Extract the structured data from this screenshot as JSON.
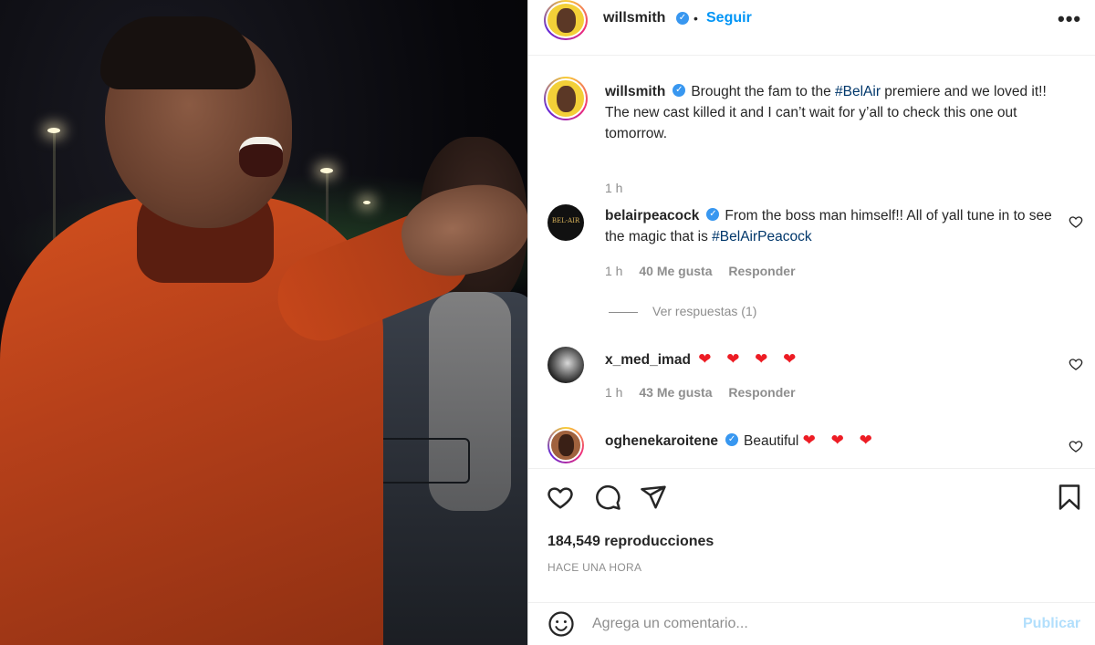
{
  "post": {
    "author": "willsmith",
    "follow_label": "Seguir",
    "dot": "•",
    "more_label": "•••",
    "caption_username": "willsmith",
    "caption_before_tag": "Brought the fam to the ",
    "caption_tag": "#BelAir",
    "caption_after_tag": " premiere and we loved it!! The new cast killed it and I can’t wait for y’all to check this one out tomorrow.",
    "caption_time": "1 h"
  },
  "comments": [
    {
      "username": "belairpeacock",
      "verified": true,
      "text_before_tag": "From the boss man himself!! All of yall tune in to see the magic that is ",
      "text_tag": "#BelAirPeacock",
      "time": "1 h",
      "likes": "40 Me gusta",
      "reply_label": "Responder",
      "view_replies": "Ver respuestas (1)",
      "avatar_text": "BEL-AIR"
    },
    {
      "username": "x_med_imad",
      "verified": false,
      "text": "❤ ❤ ❤ ❤",
      "time": "1 h",
      "likes": "43 Me gusta",
      "reply_label": "Responder"
    },
    {
      "username": "oghenekaroitene",
      "verified": true,
      "text_prefix": "Beautiful",
      "text_hearts": "❤ ❤ ❤"
    }
  ],
  "stats": {
    "views": "184,549 reproducciones",
    "time_ago": "HACE UNA HORA"
  },
  "comment_input": {
    "placeholder": "Agrega un comentario...",
    "post_label": "Publicar"
  },
  "icons": {
    "like": "heart-icon",
    "comment": "comment-icon",
    "share": "share-icon",
    "save": "bookmark-icon",
    "emoji": "emoji-icon",
    "verified": "verified-badge-icon"
  },
  "colors": {
    "link_blue": "#0095f6",
    "hashtag": "#00376b",
    "verified": "#3897f0",
    "heart_red": "#ed1c24",
    "muted": "#8e8e8e"
  }
}
